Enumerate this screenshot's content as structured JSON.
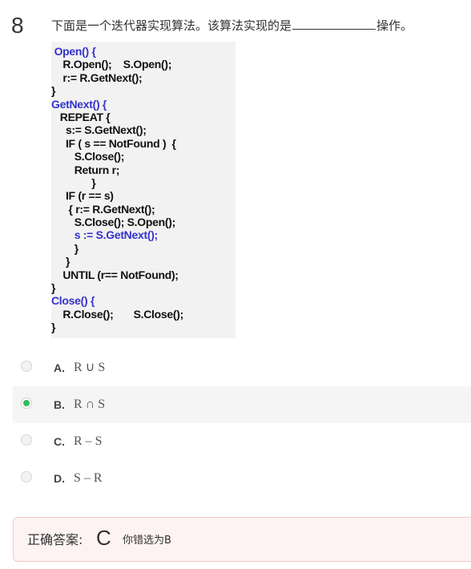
{
  "question": {
    "number": "8",
    "text_before": "下面是一个迭代器实现算法。该算法实现的是",
    "text_after": "操作。"
  },
  "code_lines": [
    {
      "text": " Open() {",
      "kw": true
    },
    {
      "text": "    R.Open();    S.Open();",
      "kw": false
    },
    {
      "text": "    r:= R.GetNext();",
      "kw": false
    },
    {
      "text": "}",
      "kw": false
    },
    {
      "text": "GetNext() {",
      "kw": true
    },
    {
      "text": "   REPEAT {",
      "kw": false
    },
    {
      "text": "     s:= S.GetNext();",
      "kw": false
    },
    {
      "text": "     IF ( s == NotFound )  {",
      "kw": false
    },
    {
      "text": "        S.Close();",
      "kw": false
    },
    {
      "text": "        Return r;",
      "kw": false
    },
    {
      "text": "              }",
      "kw": false
    },
    {
      "text": "     IF (r == s)",
      "kw": false
    },
    {
      "text": "      { r:= R.GetNext();",
      "kw": false
    },
    {
      "text": "        S.Close(); S.Open();",
      "kw": false
    },
    {
      "text": "        s := S.GetNext();",
      "kw": true
    },
    {
      "text": "        }",
      "kw": false
    },
    {
      "text": "     }",
      "kw": false
    },
    {
      "text": "    UNTIL (r== NotFound);",
      "kw": false
    },
    {
      "text": "}",
      "kw": false
    },
    {
      "text": "Close() {",
      "kw": true
    },
    {
      "text": "    R.Close();       S.Close();",
      "kw": false
    },
    {
      "text": "}",
      "kw": false
    }
  ],
  "options": [
    {
      "letter": "A.",
      "text": "R ∪ S",
      "selected": false
    },
    {
      "letter": "B.",
      "text": "R ∩ S",
      "selected": true
    },
    {
      "letter": "C.",
      "text": "R – S",
      "selected": false
    },
    {
      "letter": "D.",
      "text": "S – R",
      "selected": false
    }
  ],
  "answer": {
    "label": "正确答案:",
    "value": "C",
    "note": "你错选为B"
  },
  "colors": {
    "selected_radio": "#2dbd5c",
    "code_keyword": "#3333cc",
    "answer_box_bg": "#fdf3f3",
    "answer_box_border": "#f3c7c7"
  }
}
